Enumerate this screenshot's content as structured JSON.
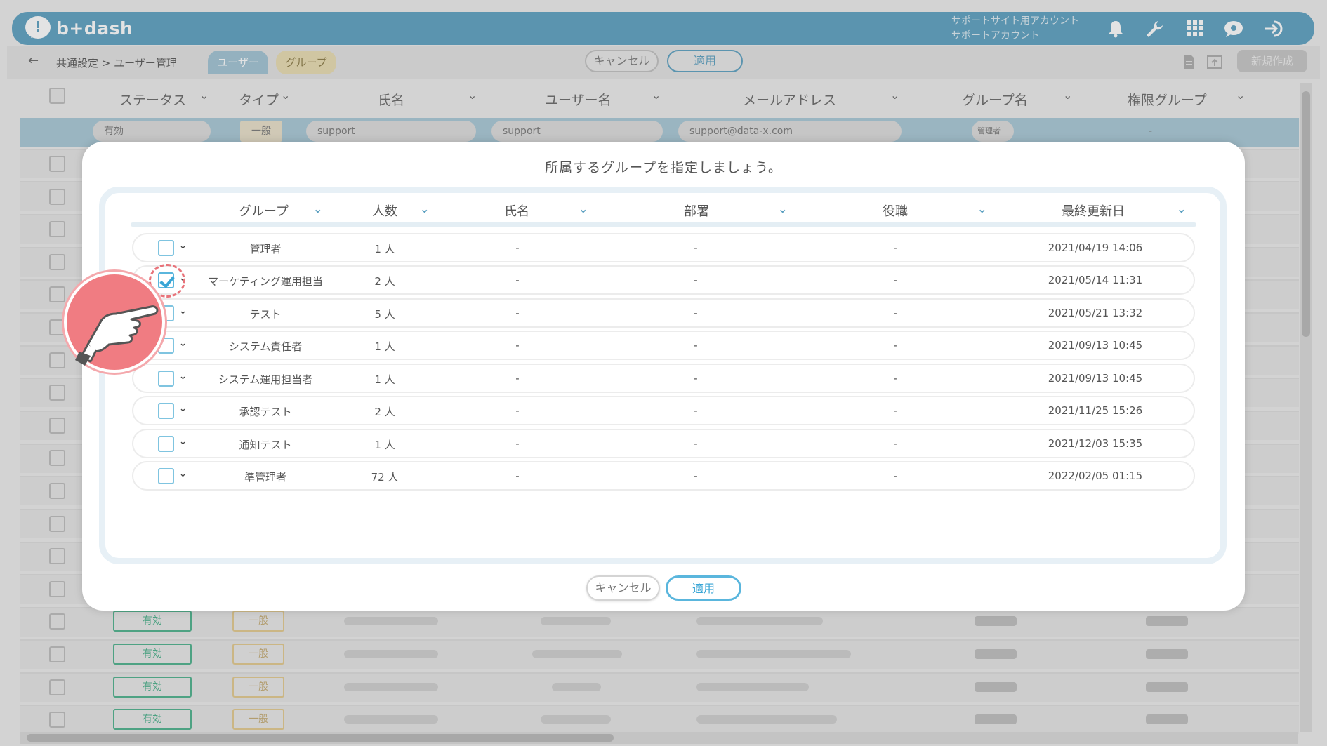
{
  "header": {
    "logo_text": "b+dash",
    "account_line1": "サポートサイト用アカウント",
    "account_line2": "サポートアカウント"
  },
  "toolbar": {
    "back_icon": "arrow-left-icon",
    "breadcrumb": "共通設定 > ユーザー管理",
    "tab_user": "ユーザー",
    "tab_group": "グループ",
    "cancel_label": "キャンセル",
    "apply_label": "適用",
    "new_label": "新規作成"
  },
  "table": {
    "headers": [
      "ステータス",
      "タイプ",
      "氏名",
      "ユーザー名",
      "メールアドレス",
      "グループ名",
      "権限グループ"
    ],
    "filter": {
      "status": "有効",
      "type": "一般",
      "name": "support",
      "username": "support",
      "email": "support@data-x.com",
      "group": "管理者",
      "perm": "-"
    },
    "row_status": "有効",
    "row_type": "一般"
  },
  "modal": {
    "title": "所属するグループを指定しましょう。",
    "columns": [
      "グループ",
      "人数",
      "氏名",
      "部署",
      "役職",
      "最終更新日"
    ],
    "rows": [
      {
        "group": "管理者",
        "count": "1 人",
        "name": "-",
        "dept": "-",
        "role": "-",
        "updated": "2021/04/19 14:06",
        "checked": false
      },
      {
        "group": "マーケティング運用担当",
        "count": "2 人",
        "name": "-",
        "dept": "-",
        "role": "-",
        "updated": "2021/05/14 11:31",
        "checked": true
      },
      {
        "group": "テスト",
        "count": "5 人",
        "name": "-",
        "dept": "-",
        "role": "-",
        "updated": "2021/05/21 13:32",
        "checked": false
      },
      {
        "group": "システム責任者",
        "count": "1 人",
        "name": "-",
        "dept": "-",
        "role": "-",
        "updated": "2021/09/13 10:45",
        "checked": false
      },
      {
        "group": "システム運用担当者",
        "count": "1 人",
        "name": "-",
        "dept": "-",
        "role": "-",
        "updated": "2021/09/13 10:45",
        "checked": false
      },
      {
        "group": "承認テスト",
        "count": "2 人",
        "name": "-",
        "dept": "-",
        "role": "-",
        "updated": "2021/11/25 15:26",
        "checked": false
      },
      {
        "group": "通知テスト",
        "count": "1 人",
        "name": "-",
        "dept": "-",
        "role": "-",
        "updated": "2021/12/03 15:35",
        "checked": false
      },
      {
        "group": "準管理者",
        "count": "72 人",
        "name": "-",
        "dept": "-",
        "role": "-",
        "updated": "2022/02/05 01:15",
        "checked": false
      }
    ],
    "cancel_label": "キャンセル",
    "apply_label": "適用"
  },
  "colors": {
    "brand": "#5a9fc0",
    "accent": "#3aa6d6",
    "pointer": "#f07c82",
    "status_green": "#4ab08a"
  }
}
